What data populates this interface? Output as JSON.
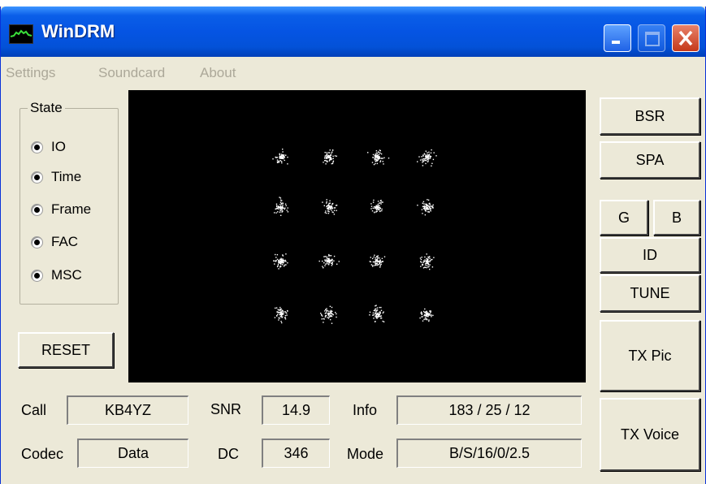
{
  "window": {
    "title": "WinDRM"
  },
  "menu": [
    "Settings",
    "Soundcard",
    "About"
  ],
  "state": {
    "label": "State",
    "options": [
      "IO",
      "Time",
      "Frame",
      "FAC",
      "MSC"
    ]
  },
  "buttons": {
    "reset": "RESET",
    "bsr": "BSR",
    "spa": "SPA",
    "g": "G",
    "b": "B",
    "id": "ID",
    "tune": "TUNE",
    "tx_pic": "TX Pic",
    "tx_voice": "TX Voice"
  },
  "fields": {
    "call_label": "Call",
    "call_value": "KB4YZ",
    "codec_label": "Codec",
    "codec_value": "Data",
    "snr_label": "SNR",
    "snr_value": "14.9",
    "dc_label": "DC",
    "dc_value": "346",
    "info_label": "Info",
    "info_value": "183 / 25 / 12",
    "mode_label": "Mode",
    "mode_value": "B/S/16/0/2.5"
  },
  "colors": {
    "titlebar": "#0554e3",
    "face": "#ece9d8",
    "scope_bg": "#000000",
    "scope_dots": "#ffffff"
  }
}
